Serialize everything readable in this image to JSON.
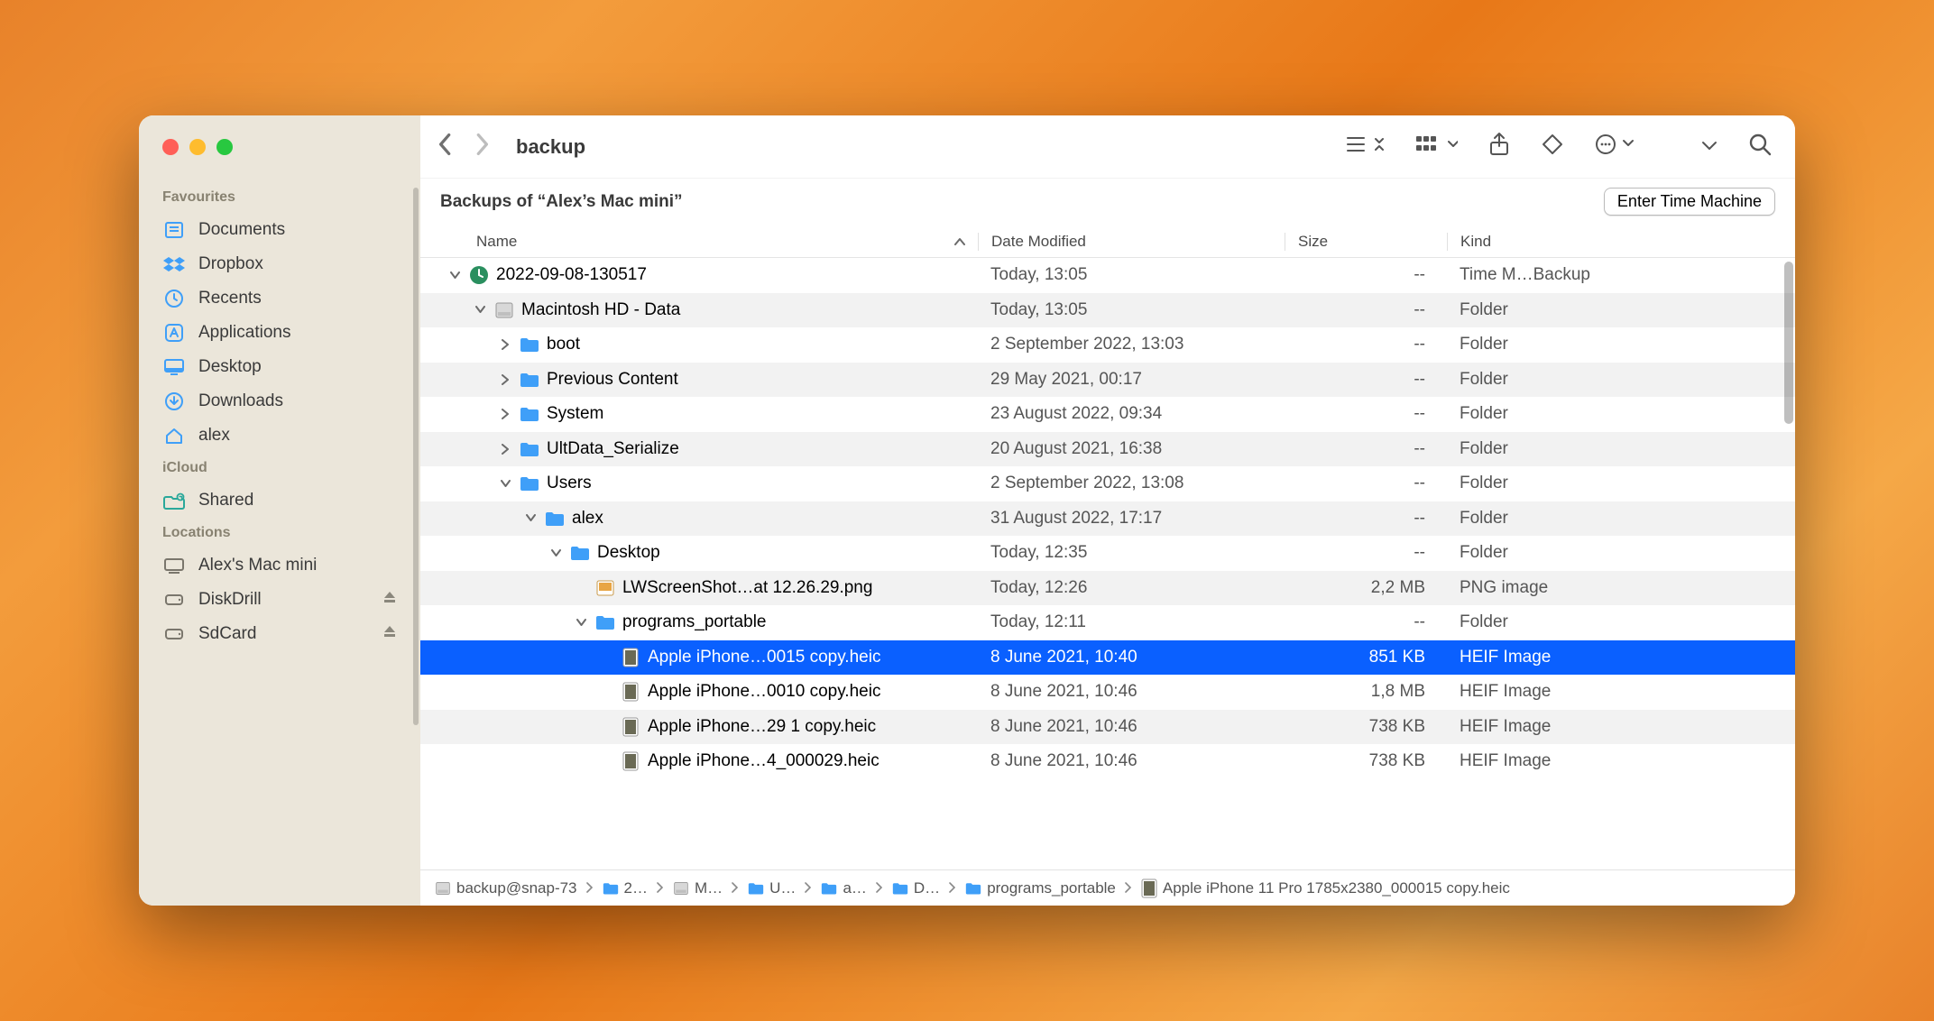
{
  "window": {
    "title": "backup"
  },
  "sidebar": {
    "sections": [
      {
        "header": "Favourites",
        "items": [
          {
            "name": "documents",
            "label": "Documents",
            "icon": "doc"
          },
          {
            "name": "dropbox",
            "label": "Dropbox",
            "icon": "dropbox"
          },
          {
            "name": "recents",
            "label": "Recents",
            "icon": "clock"
          },
          {
            "name": "applications",
            "label": "Applications",
            "icon": "app"
          },
          {
            "name": "desktop",
            "label": "Desktop",
            "icon": "desktop"
          },
          {
            "name": "downloads",
            "label": "Downloads",
            "icon": "download"
          },
          {
            "name": "alex",
            "label": "alex",
            "icon": "home"
          }
        ]
      },
      {
        "header": "iCloud",
        "items": [
          {
            "name": "shared",
            "label": "Shared",
            "icon": "shared",
            "teal": true
          }
        ]
      },
      {
        "header": "Locations",
        "items": [
          {
            "name": "macmini",
            "label": "Alex's Mac mini",
            "icon": "computer",
            "gray": true
          },
          {
            "name": "diskdrill",
            "label": "DiskDrill",
            "icon": "disk",
            "gray": true,
            "eject": true
          },
          {
            "name": "sdcard",
            "label": "SdCard",
            "icon": "disk",
            "gray": true,
            "eject": true
          }
        ]
      }
    ]
  },
  "subheader": {
    "text": "Backups of “Alex’s Mac mini”",
    "button": "Enter Time Machine"
  },
  "columns": {
    "name": "Name",
    "date": "Date Modified",
    "size": "Size",
    "kind": "Kind"
  },
  "rows": [
    {
      "indent": 0,
      "disc": "down",
      "icon": "tm",
      "name": "2022-09-08-130517",
      "date": "Today, 13:05",
      "size": "--",
      "kind": "Time M…Backup"
    },
    {
      "indent": 1,
      "disc": "down",
      "icon": "hd",
      "name": "Macintosh HD - Data",
      "date": "Today, 13:05",
      "size": "--",
      "kind": "Folder",
      "alt": true
    },
    {
      "indent": 2,
      "disc": "right",
      "icon": "folder",
      "name": "boot",
      "date": "2 September 2022, 13:03",
      "size": "--",
      "kind": "Folder"
    },
    {
      "indent": 2,
      "disc": "right",
      "icon": "folder",
      "name": "Previous Content",
      "date": "29 May 2021, 00:17",
      "size": "--",
      "kind": "Folder",
      "alt": true
    },
    {
      "indent": 2,
      "disc": "right",
      "icon": "folder",
      "name": "System",
      "date": "23 August 2022, 09:34",
      "size": "--",
      "kind": "Folder"
    },
    {
      "indent": 2,
      "disc": "right",
      "icon": "folder",
      "name": "UltData_Serialize",
      "date": "20 August 2021, 16:38",
      "size": "--",
      "kind": "Folder",
      "alt": true
    },
    {
      "indent": 2,
      "disc": "down",
      "icon": "folder",
      "name": "Users",
      "date": "2 September 2022, 13:08",
      "size": "--",
      "kind": "Folder"
    },
    {
      "indent": 3,
      "disc": "down",
      "icon": "folder",
      "name": "alex",
      "date": "31 August 2022, 17:17",
      "size": "--",
      "kind": "Folder",
      "alt": true
    },
    {
      "indent": 4,
      "disc": "down",
      "icon": "folder",
      "name": "Desktop",
      "date": "Today, 12:35",
      "size": "--",
      "kind": "Folder"
    },
    {
      "indent": 5,
      "disc": "",
      "icon": "png",
      "name": "LWScreenShot…at 12.26.29.png",
      "date": "Today, 12:26",
      "size": "2,2 MB",
      "kind": "PNG image",
      "alt": true
    },
    {
      "indent": 5,
      "disc": "down",
      "icon": "folder",
      "name": "programs_portable",
      "date": "Today, 12:11",
      "size": "--",
      "kind": "Folder"
    },
    {
      "indent": 6,
      "disc": "",
      "icon": "heic",
      "name": "Apple iPhone…0015 copy.heic",
      "date": "8 June 2021, 10:40",
      "size": "851 KB",
      "kind": "HEIF Image",
      "sel": true
    },
    {
      "indent": 6,
      "disc": "",
      "icon": "heic",
      "name": "Apple iPhone…0010 copy.heic",
      "date": "8 June 2021, 10:46",
      "size": "1,8 MB",
      "kind": "HEIF Image"
    },
    {
      "indent": 6,
      "disc": "",
      "icon": "heic",
      "name": "Apple iPhone…29 1 copy.heic",
      "date": "8 June 2021, 10:46",
      "size": "738 KB",
      "kind": "HEIF Image",
      "alt": true
    },
    {
      "indent": 6,
      "disc": "",
      "icon": "heic",
      "name": "Apple iPhone…4_000029.heic",
      "date": "8 June 2021, 10:46",
      "size": "738 KB",
      "kind": "HEIF Image"
    }
  ],
  "pathbar": [
    {
      "icon": "hd",
      "label": "backup@snap-73"
    },
    {
      "icon": "folder",
      "label": "2…"
    },
    {
      "icon": "hd",
      "label": "M…"
    },
    {
      "icon": "folder",
      "label": "U…"
    },
    {
      "icon": "folder",
      "label": "a…"
    },
    {
      "icon": "folder",
      "label": "D…"
    },
    {
      "icon": "folder",
      "label": "programs_portable"
    },
    {
      "icon": "heic",
      "label": "Apple iPhone 11 Pro 1785x2380_000015 copy.heic"
    }
  ]
}
